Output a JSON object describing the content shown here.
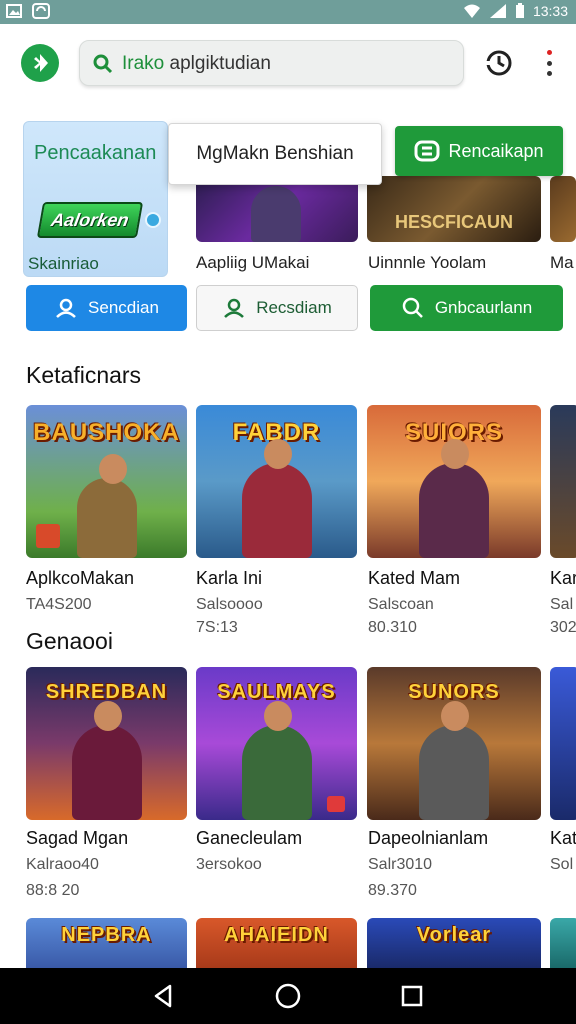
{
  "status_bar": {
    "time": "13:33",
    "icons": [
      "photo-icon",
      "sync-icon",
      "wifi-icon",
      "signal-icon",
      "battery-icon"
    ]
  },
  "app_bar": {
    "search_prefix": "Irako",
    "search_text": " aplgiktudian",
    "accent": "#1fa14a"
  },
  "featured": {
    "card_title": "Pencaakanan",
    "card_logo_text": "Aalorken",
    "card_subtitle": "Skainriao",
    "overlay_label": "MgMakn Benshian",
    "green_button_label": "Rencaikapn",
    "mini_items": [
      {
        "label": "Aapliig UMakai"
      },
      {
        "label": "Uinnnle Yoolam"
      },
      {
        "label": "Ma"
      }
    ],
    "action_buttons": [
      {
        "label": "Sencdian",
        "style": "blue"
      },
      {
        "label": "Recsdiam",
        "style": "white"
      },
      {
        "label": "Gnbcaurlann",
        "style": "green"
      }
    ]
  },
  "sections": [
    {
      "title": "Ketaficnars",
      "items": [
        {
          "thumb_title": "BAUSHOKA",
          "name": "AplkcoMakan",
          "meta1": "TA4S200",
          "meta2": ""
        },
        {
          "thumb_title": "FABDR",
          "name": "Karla Ini",
          "meta1": "Salsoooo",
          "meta2": "7S:13"
        },
        {
          "thumb_title": "SUIORS",
          "name": "Kated Mam",
          "meta1": "Salscoan",
          "meta2": "80.310"
        },
        {
          "thumb_title": "",
          "name": "Kar",
          "meta1": "Sal",
          "meta2": "302"
        }
      ]
    },
    {
      "title": "Genaooi",
      "items": [
        {
          "thumb_title": "SHREDBAN",
          "name": "Sagad Mgan",
          "meta1": "Kalraoo40",
          "meta2": "88:8 20"
        },
        {
          "thumb_title": "SAULMAYS",
          "name": "Ganecleulam",
          "meta1": "3ersokoo",
          "meta2": ""
        },
        {
          "thumb_title": "SUNORS",
          "name": "Dapeolnianlam",
          "meta1": "Salr3010",
          "meta2": "89.370"
        },
        {
          "thumb_title": "",
          "name": "Kat",
          "meta1": "Sol",
          "meta2": ""
        }
      ]
    },
    {
      "title": "",
      "items": [
        {
          "thumb_title": "NEPBRA"
        },
        {
          "thumb_title": "AHAIEIDN"
        },
        {
          "thumb_title": "Vorlear"
        },
        {
          "thumb_title": ""
        }
      ]
    }
  ],
  "nav_bar": {
    "items": [
      "back-icon",
      "home-icon",
      "recents-icon"
    ]
  }
}
